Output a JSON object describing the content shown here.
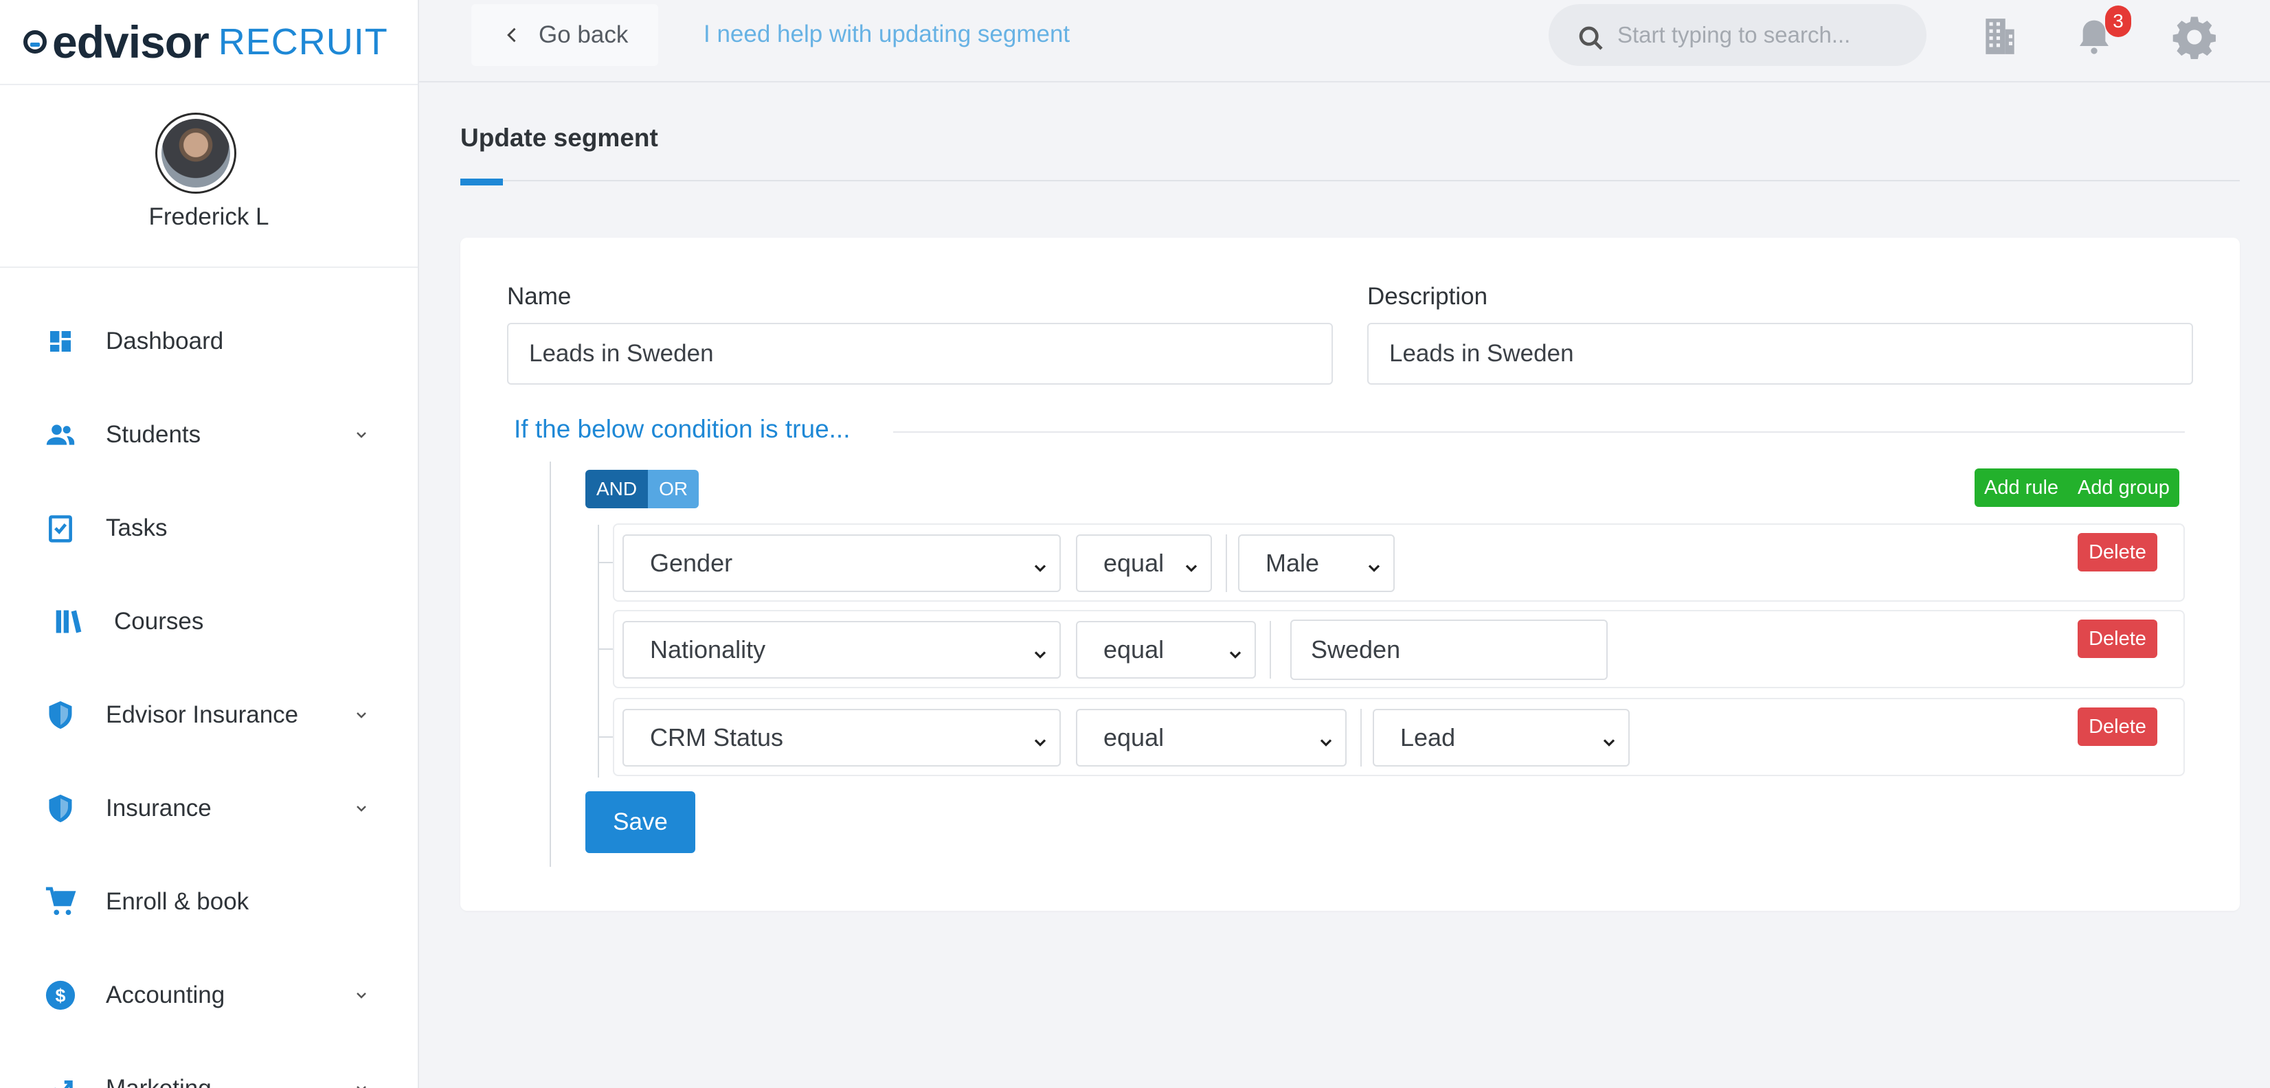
{
  "app": {
    "logo_main": "edvisor",
    "logo_sub": "RECRUIT"
  },
  "user": {
    "name": "Frederick L"
  },
  "sidebar": {
    "items": [
      {
        "label": "Dashboard",
        "icon": "dashboard-icon",
        "has_chevron": false
      },
      {
        "label": "Students",
        "icon": "users-icon",
        "has_chevron": true
      },
      {
        "label": "Tasks",
        "icon": "clipboard-check-icon",
        "has_chevron": false
      },
      {
        "label": "Courses",
        "icon": "books-icon",
        "has_chevron": false
      },
      {
        "label": "Edvisor Insurance",
        "icon": "shield-icon",
        "has_chevron": true
      },
      {
        "label": "Insurance",
        "icon": "shield-icon",
        "has_chevron": true
      },
      {
        "label": "Enroll & book",
        "icon": "cart-icon",
        "has_chevron": false
      },
      {
        "label": "Accounting",
        "icon": "dollar-circle-icon",
        "has_chevron": true
      },
      {
        "label": "Marketing",
        "icon": "chart-line-icon",
        "has_chevron": true
      }
    ]
  },
  "header": {
    "go_back": "Go back",
    "help_link": "I need help with updating segment",
    "search_placeholder": "Start typing to search...",
    "notification_count": "3"
  },
  "page": {
    "title": "Update segment"
  },
  "form": {
    "name_label": "Name",
    "name_value": "Leads in Sweden",
    "description_label": "Description",
    "description_value": "Leads in Sweden",
    "condition_title": "If the below condition is true...",
    "and_label": "AND",
    "or_label": "OR",
    "add_rule": "Add rule",
    "add_group": "Add group",
    "delete_label": "Delete",
    "save_label": "Save",
    "rules": [
      {
        "field": "Gender",
        "operator": "equal",
        "value": "Male",
        "value_type": "select"
      },
      {
        "field": "Nationality",
        "operator": "equal",
        "value": "Sweden",
        "value_type": "input"
      },
      {
        "field": "CRM Status",
        "operator": "equal",
        "value": "Lead",
        "value_type": "select"
      }
    ]
  },
  "colors": {
    "accent": "#1e88d6",
    "success": "#23b12c",
    "danger": "#e0474c",
    "and_active": "#1867a5"
  }
}
